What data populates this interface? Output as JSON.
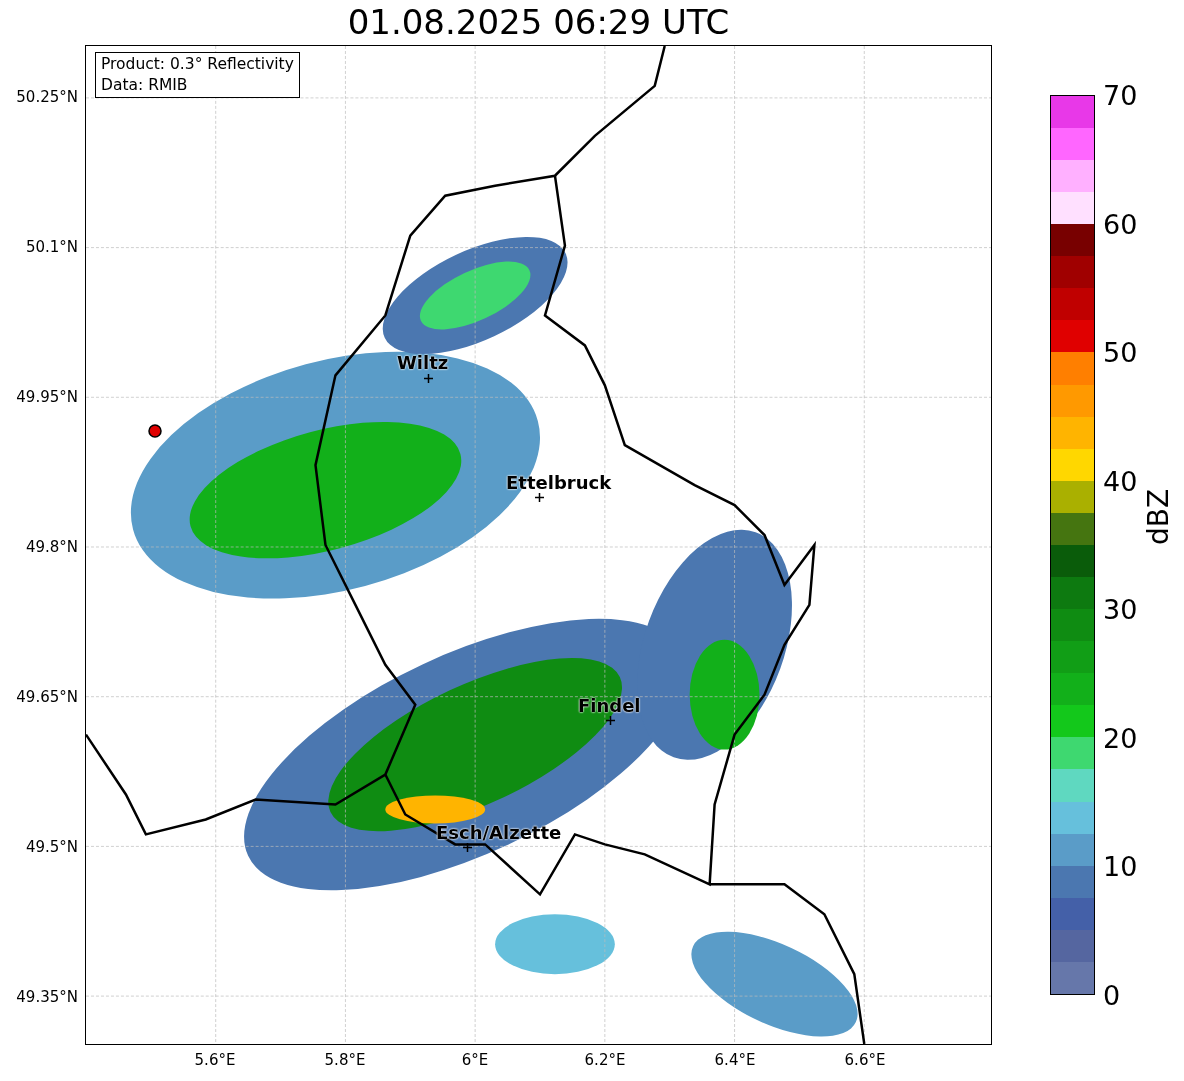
{
  "title": "01.08.2025 06:29 UTC",
  "info_box": [
    "Product: 0.3° Reflectivity",
    "Data: RMIB"
  ],
  "y_ticks": [
    "50.25°N",
    "50.1°N",
    "49.95°N",
    "49.8°N",
    "49.65°N",
    "49.5°N",
    "49.35°N"
  ],
  "x_ticks": [
    "5.6°E",
    "5.8°E",
    "6°E",
    "6.2°E",
    "6.4°E",
    "6.6°E"
  ],
  "cities": [
    {
      "name": "Wiltz"
    },
    {
      "name": "Ettelbruck"
    },
    {
      "name": "Findel"
    },
    {
      "name": "Esch/Alzette"
    }
  ],
  "colorbar": {
    "label": "dBZ",
    "ticks": [
      "70",
      "60",
      "50",
      "40",
      "30",
      "20",
      "10",
      "0"
    ],
    "segments": [
      {
        "color": "#6677aa"
      },
      {
        "color": "#5566a0"
      },
      {
        "color": "#4460a8"
      },
      {
        "color": "#4b77b0"
      },
      {
        "color": "#5a9cc8"
      },
      {
        "color": "#66c0dc"
      },
      {
        "color": "#5fd8c0"
      },
      {
        "color": "#3ed870"
      },
      {
        "color": "#13c81b"
      },
      {
        "color": "#12b01a"
      },
      {
        "color": "#119e16"
      },
      {
        "color": "#0f8c12"
      },
      {
        "color": "#0d7a10"
      },
      {
        "color": "#0a5c0a"
      },
      {
        "color": "#457510"
      },
      {
        "color": "#aab000"
      },
      {
        "color": "#ffd700"
      },
      {
        "color": "#ffb400"
      },
      {
        "color": "#ff9900"
      },
      {
        "color": "#ff7f00"
      },
      {
        "color": "#e00000"
      },
      {
        "color": "#c00000"
      },
      {
        "color": "#a00000"
      },
      {
        "color": "#780000"
      },
      {
        "color": "#ffe0ff"
      },
      {
        "color": "#ffb0ff"
      },
      {
        "color": "#ff66ff"
      },
      {
        "color": "#e838e8"
      }
    ]
  }
}
